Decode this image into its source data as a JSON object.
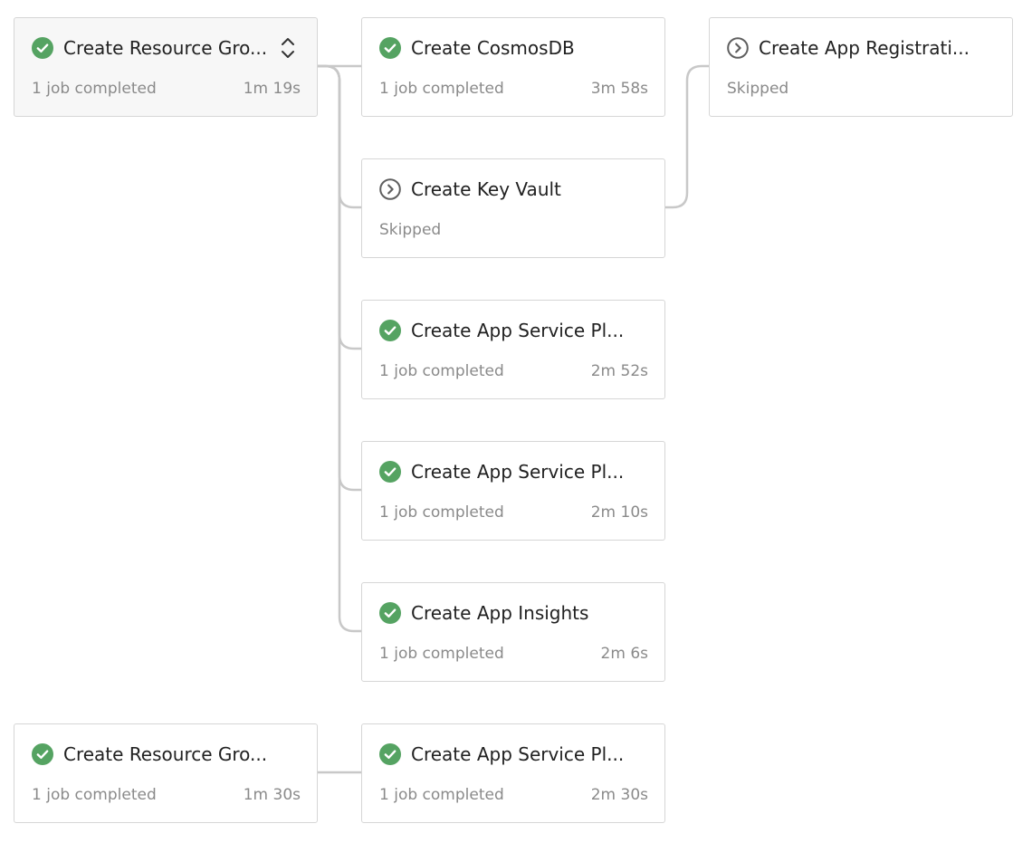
{
  "stages": [
    {
      "id": "rg1",
      "title": "Create Resource Gro...",
      "status": "succeeded",
      "status_icon": "check-circle-icon",
      "summary": "1 job completed",
      "duration": "1m 19s",
      "expandable": true
    },
    {
      "id": "cosmos",
      "title": "Create CosmosDB",
      "status": "succeeded",
      "status_icon": "check-circle-icon",
      "summary": "1 job completed",
      "duration": "3m 58s"
    },
    {
      "id": "appreg",
      "title": "Create App Registrati...",
      "status": "skipped",
      "status_icon": "skipped-chevron-icon",
      "summary": "Skipped",
      "duration": ""
    },
    {
      "id": "keyvault",
      "title": "Create Key Vault",
      "status": "skipped",
      "status_icon": "skipped-chevron-icon",
      "summary": "Skipped",
      "duration": ""
    },
    {
      "id": "asp1",
      "title": "Create App Service Pl...",
      "status": "succeeded",
      "status_icon": "check-circle-icon",
      "summary": "1 job completed",
      "duration": "2m 52s"
    },
    {
      "id": "asp2",
      "title": "Create App Service Pl...",
      "status": "succeeded",
      "status_icon": "check-circle-icon",
      "summary": "1 job completed",
      "duration": "2m 10s"
    },
    {
      "id": "insights",
      "title": "Create App Insights",
      "status": "succeeded",
      "status_icon": "check-circle-icon",
      "summary": "1 job completed",
      "duration": "2m 6s"
    },
    {
      "id": "rg2",
      "title": "Create Resource Gro...",
      "status": "succeeded",
      "status_icon": "check-circle-icon",
      "summary": "1 job completed",
      "duration": "1m 30s"
    },
    {
      "id": "asp3",
      "title": "Create App Service Pl...",
      "status": "succeeded",
      "status_icon": "check-circle-icon",
      "summary": "1 job completed",
      "duration": "2m 30s"
    }
  ],
  "colors": {
    "success": "#55a362",
    "skipped": "#5f5f5f",
    "connector": "#c8c8c8",
    "card_border": "#d6d6d6",
    "selected_bg": "#f7f7f7"
  },
  "expand_icon": "expand-collapse-icon"
}
